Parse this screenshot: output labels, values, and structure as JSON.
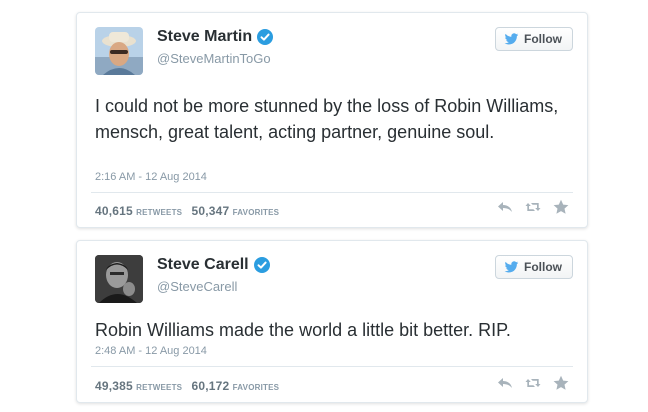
{
  "tweets": [
    {
      "name": "Steve Martin",
      "handle": "@SteveMartinToGo",
      "follow_label": "Follow",
      "text": "I could not be more stunned by the loss of Robin Williams, mensch, great talent, acting partner, genuine soul.",
      "timestamp": "2:16 AM - 12 Aug 2014",
      "retweets": "40,615",
      "retweets_label": "RETWEETS",
      "favorites": "50,347",
      "favorites_label": "FAVORITES"
    },
    {
      "name": "Steve Carell",
      "handle": "@SteveCarell",
      "follow_label": "Follow",
      "text": "Robin Williams made the world a little bit better. RIP.",
      "timestamp": "2:48 AM - 12 Aug 2014",
      "retweets": "49,385",
      "retweets_label": "RETWEETS",
      "favorites": "60,172",
      "favorites_label": "FAVORITES"
    }
  ],
  "icons": {
    "verified": "verified-badge-icon",
    "follow": "twitter-bird-icon",
    "reply": "reply-icon",
    "retweet": "retweet-icon",
    "favorite": "star-icon"
  },
  "colors": {
    "verified": "#2b9de0",
    "bird": "#55acee",
    "muted": "#8899a6",
    "action_icon": "#a8b3bb"
  }
}
